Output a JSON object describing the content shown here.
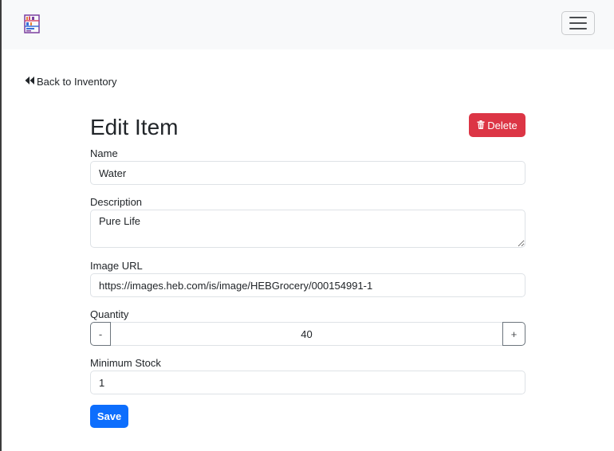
{
  "nav": {
    "logo_icon": "inventory-shelf-icon",
    "toggler_icon": "hamburger-menu-icon"
  },
  "back_link": {
    "icon": "double-chevron-left-icon",
    "label": "Back to Inventory"
  },
  "page": {
    "title": "Edit Item"
  },
  "delete_button": {
    "icon": "trash-icon",
    "label": "Delete",
    "color": "#dc3545"
  },
  "form": {
    "name": {
      "label": "Name",
      "value": "Water"
    },
    "description": {
      "label": "Description",
      "value": "Pure Life"
    },
    "image_url": {
      "label": "Image URL",
      "value": "https://images.heb.com/is/image/HEBGrocery/000154991-1"
    },
    "quantity": {
      "label": "Quantity",
      "value": "40",
      "decrement_label": "-",
      "increment_label": "+"
    },
    "minimum_stock": {
      "label": "Minimum Stock",
      "value": "1"
    }
  },
  "save_button": {
    "label": "Save",
    "color": "#0d6efd"
  }
}
